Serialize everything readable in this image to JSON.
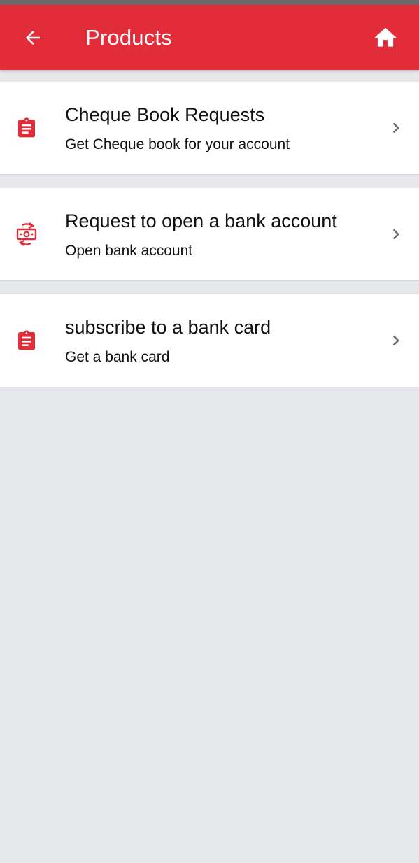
{
  "app_bar": {
    "title": "Products",
    "back_icon": "arrow-left-icon",
    "home_icon": "home-icon",
    "color": "#e32c3a"
  },
  "products": [
    {
      "title": "Cheque Book Requests",
      "subtitle": "Get Cheque book for your account",
      "icon": "clipboard-icon"
    },
    {
      "title": "Request to open a bank account",
      "subtitle": "Open bank account",
      "icon": "money-exchange-icon"
    },
    {
      "title": "subscribe to a bank card",
      "subtitle": "Get a bank card",
      "icon": "clipboard-icon"
    }
  ],
  "colors": {
    "accent": "#e32c3a",
    "background": "#e7e8ec",
    "chevron": "#6b6b6b"
  }
}
